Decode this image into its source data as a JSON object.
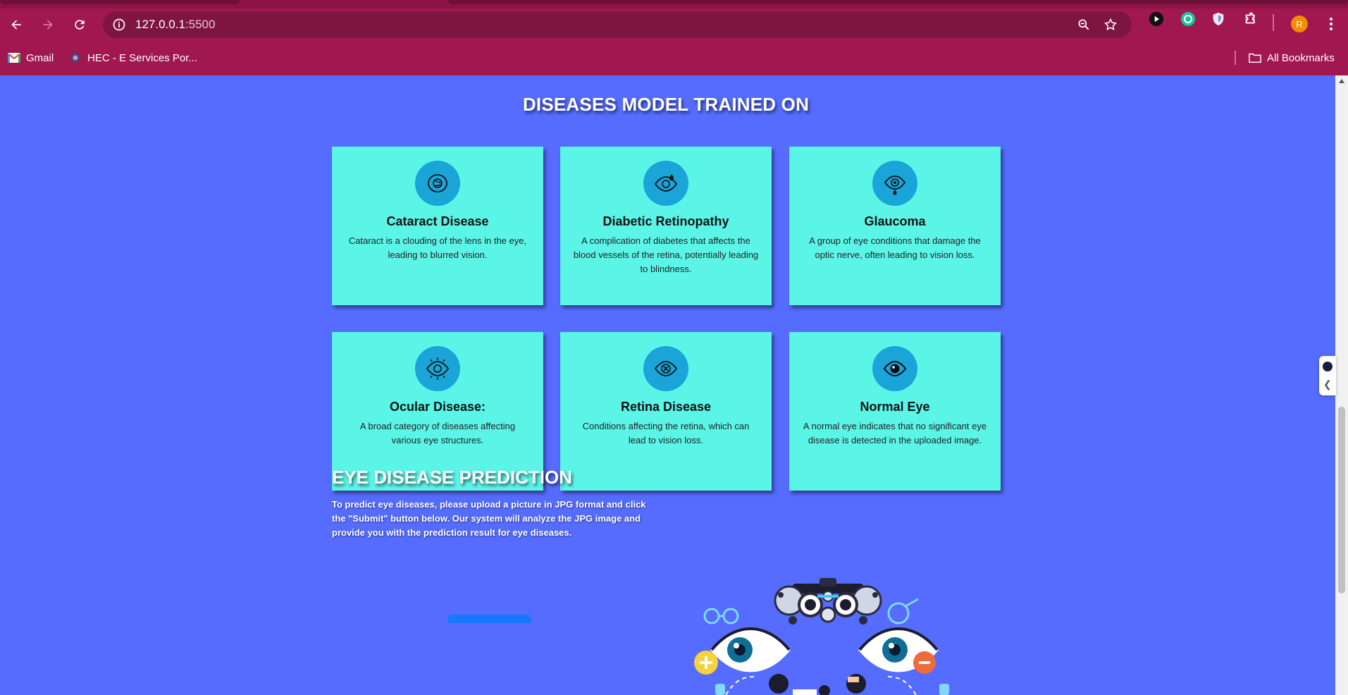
{
  "browser": {
    "url_host": "127.0.0.1",
    "url_port": ":5500",
    "avatar_initial": "R",
    "bookmarks": [
      {
        "label": "Gmail",
        "icon": "gmail-icon"
      },
      {
        "label": "HEC - E Services Por...",
        "icon": "hec-icon"
      }
    ],
    "all_bookmarks_label": "All Bookmarks",
    "colors": {
      "frame": "#a1174f",
      "omnibox": "#7d1540"
    }
  },
  "diseases": {
    "title": "DISEASES MODEL TRAINED ON",
    "cards": [
      {
        "title": "Cataract Disease",
        "description": "Cataract is a clouding of the lens in the eye, leading to blurred vision.",
        "icon": "cataract-eye-icon"
      },
      {
        "title": "Diabetic Retinopathy",
        "description": "A complication of diabetes that affects the blood vessels of the retina, potentially leading to blindness.",
        "icon": "diabetic-eye-icon"
      },
      {
        "title": "Glaucoma",
        "description": "A group of eye conditions that damage the optic nerve, often leading to vision loss.",
        "icon": "glaucoma-eye-icon"
      },
      {
        "title": "Ocular Disease:",
        "description": "A broad category of diseases affecting various eye structures.",
        "icon": "ocular-eye-icon"
      },
      {
        "title": "Retina Disease",
        "description": "Conditions affecting the retina, which can lead to vision loss.",
        "icon": "retina-eye-icon"
      },
      {
        "title": "Normal Eye",
        "description": "A normal eye indicates that no significant eye disease is detected in the uploaded image.",
        "icon": "normal-eye-icon"
      }
    ],
    "colors": {
      "page_bg": "#556cff",
      "card_bg": "#5bf5e8",
      "icon_bg": "#1aa4d8"
    }
  },
  "prediction": {
    "title": "EYE DISEASE PREDICTION",
    "description": "To predict eye diseases, please upload a picture in JPG format and click the \"Submit\" button below. Our system will analyze the JPG image and provide you with the prediction result for eye diseases."
  }
}
